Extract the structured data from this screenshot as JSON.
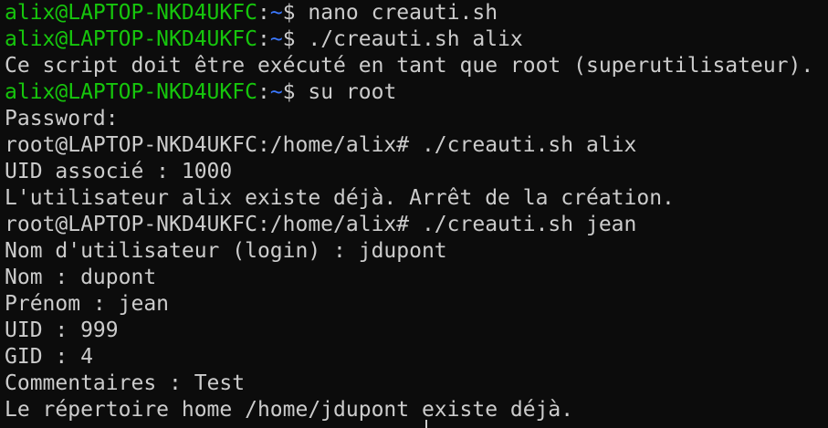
{
  "terminal": {
    "colors": {
      "background": "#0c0c0c",
      "text": "#cccccc",
      "user_host": "#16c60c",
      "path": "#3b78ff"
    },
    "lines": [
      {
        "type": "prompt",
        "user_host": "alix@LAPTOP-NKD4UKFC",
        "sep": ":",
        "path": "~",
        "symbol": "$",
        "command": " nano creauti.sh"
      },
      {
        "type": "prompt",
        "user_host": "alix@LAPTOP-NKD4UKFC",
        "sep": ":",
        "path": "~",
        "symbol": "$",
        "command": " ./creauti.sh alix"
      },
      {
        "type": "output",
        "text": "Ce script doit être exécuté en tant que root (superutilisateur)."
      },
      {
        "type": "prompt",
        "user_host": "alix@LAPTOP-NKD4UKFC",
        "sep": ":",
        "path": "~",
        "symbol": "$",
        "command": " su root"
      },
      {
        "type": "output",
        "text": "Password:"
      },
      {
        "type": "output",
        "text": "root@LAPTOP-NKD4UKFC:/home/alix# ./creauti.sh alix"
      },
      {
        "type": "output",
        "text": "UID associé : 1000"
      },
      {
        "type": "output",
        "text": "L'utilisateur alix existe déjà. Arrêt de la création."
      },
      {
        "type": "output",
        "text": "root@LAPTOP-NKD4UKFC:/home/alix# ./creauti.sh jean"
      },
      {
        "type": "output",
        "text": "Nom d'utilisateur (login) : jdupont"
      },
      {
        "type": "output",
        "text": "Nom : dupont"
      },
      {
        "type": "output",
        "text": "Prénom : jean"
      },
      {
        "type": "output",
        "text": "UID : 999"
      },
      {
        "type": "output",
        "text": "GID : 4"
      },
      {
        "type": "output",
        "text": "Commentaires : Test"
      },
      {
        "type": "output",
        "text": "Le répertoire home /home/jdupont existe déjà."
      }
    ]
  }
}
